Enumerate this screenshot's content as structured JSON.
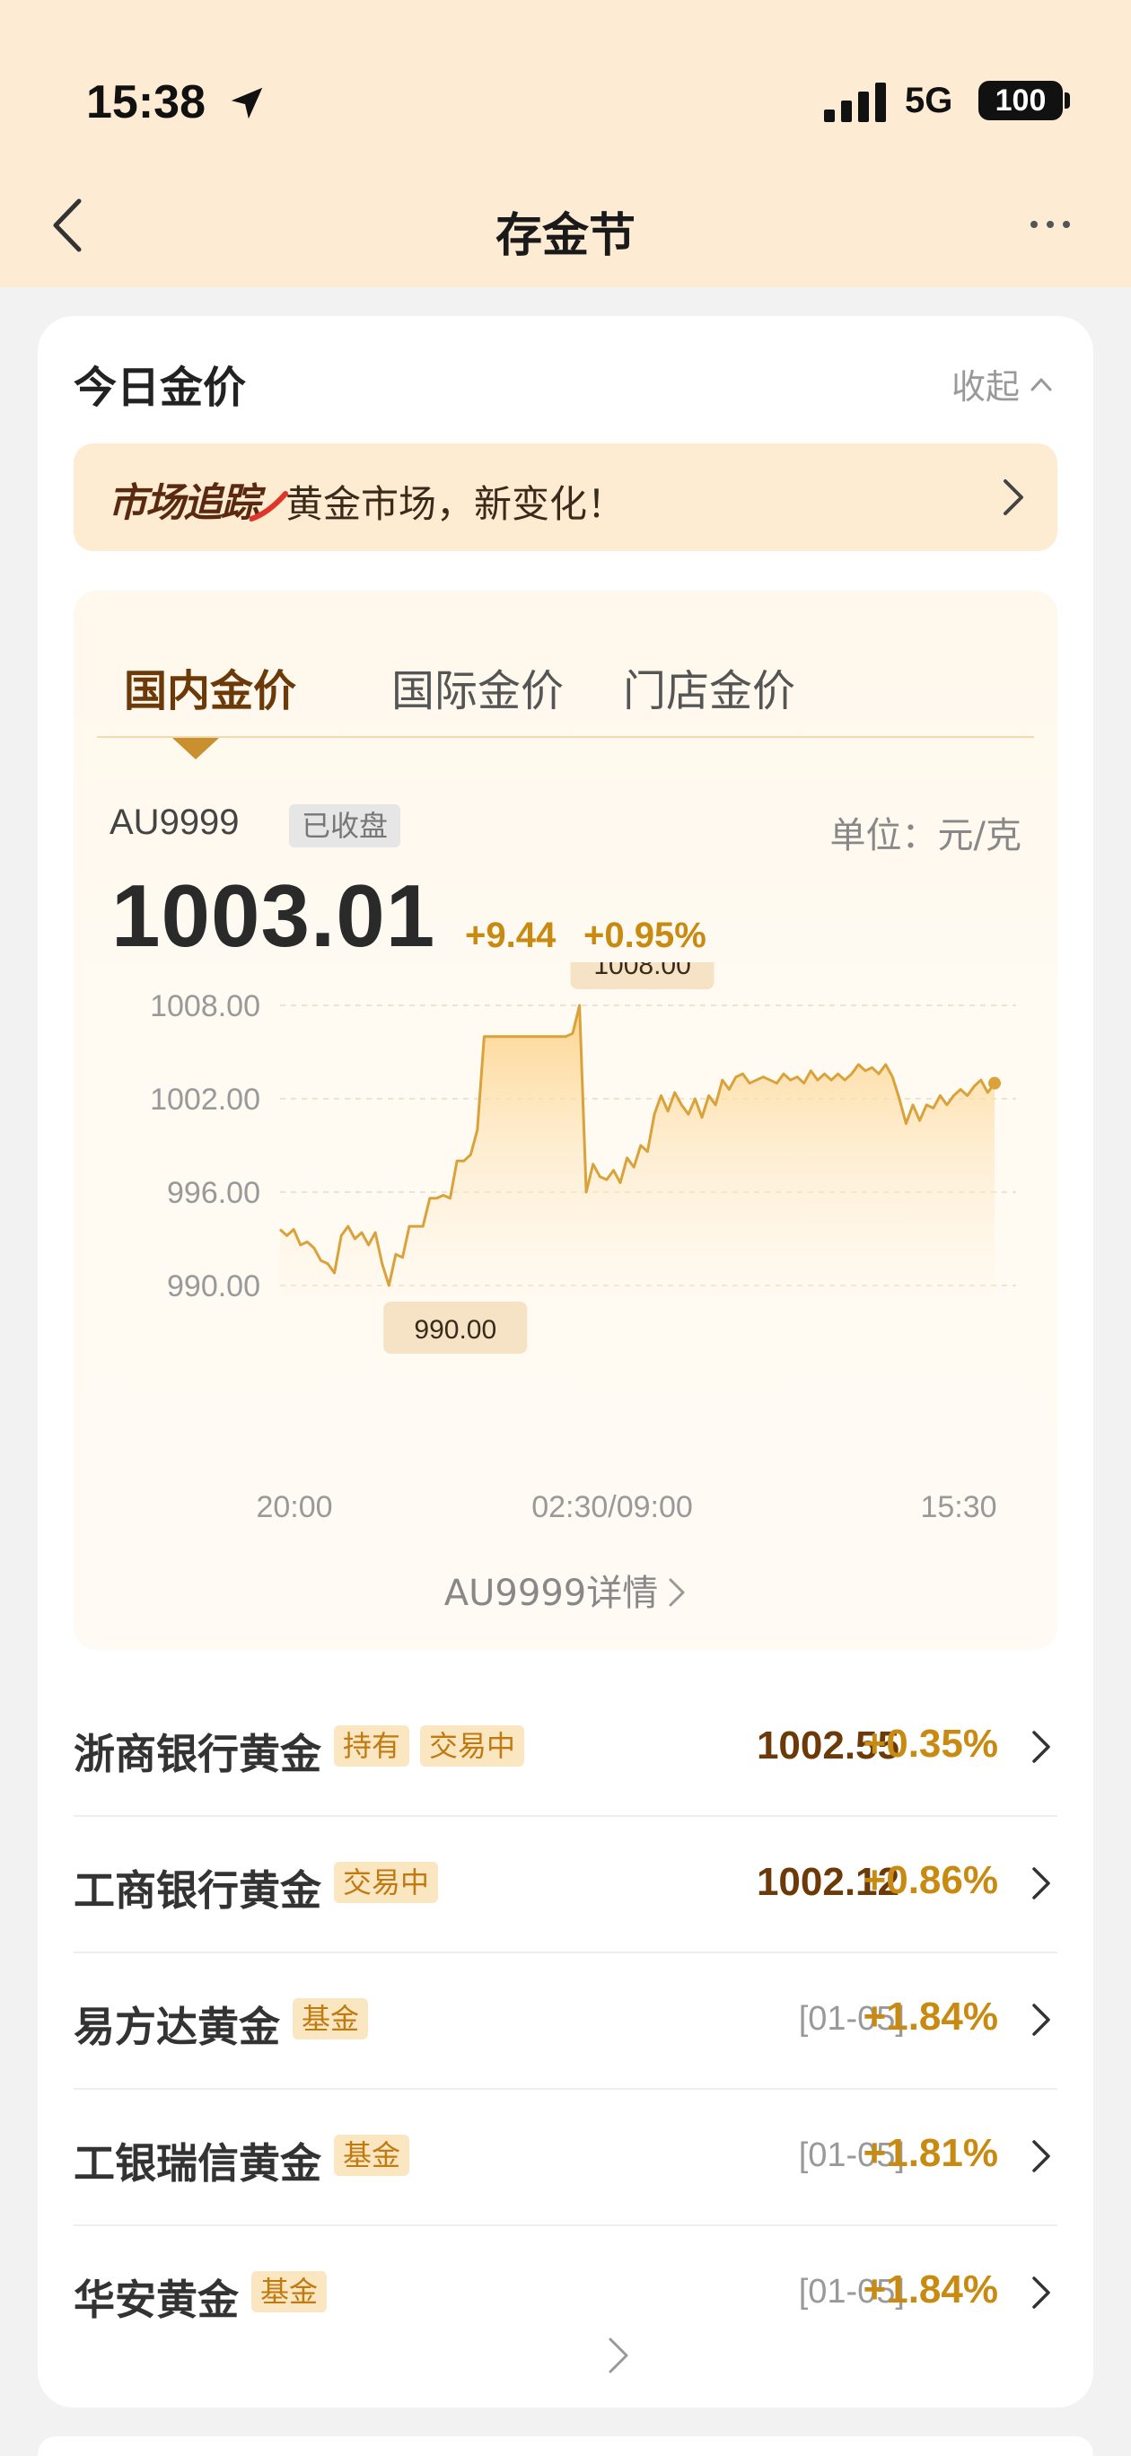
{
  "status_bar": {
    "time": "15:38",
    "network": "5G",
    "battery": "100",
    "icons": [
      "location-arrow-icon",
      "signal-icon",
      "battery-icon"
    ]
  },
  "nav": {
    "title": "存金节",
    "icons": [
      "back-icon",
      "more-icon"
    ]
  },
  "card": {
    "title": "今日金价",
    "collapse_label": "收起"
  },
  "banner": {
    "brand": "市场追踪",
    "text": "黄金市场，新变化！"
  },
  "tabs": [
    {
      "label": "国内金价",
      "active": true
    },
    {
      "label": "国际金价",
      "active": false
    },
    {
      "label": "门店金价",
      "active": false
    }
  ],
  "quote": {
    "symbol": "AU9999",
    "status": "已收盘",
    "unit": "单位：元/克",
    "price": "1003.01",
    "change": "+9.44",
    "change_pct": "+0.95%"
  },
  "chart_data": {
    "type": "area",
    "y_ticks": [
      "1008.00",
      "1002.00",
      "996.00",
      "990.00"
    ],
    "x_ticks": [
      "20:00",
      "02:30/09:00",
      "15:30"
    ],
    "ylim": [
      990,
      1008
    ],
    "max_label": "1008.00",
    "min_label": "990.00",
    "colors": {
      "line": "#d9a23a",
      "fill_top": "#fcd38a",
      "fill_bottom": "#fff6e6"
    },
    "series": [
      {
        "values": [
          993.6,
          993.2,
          993.6,
          992.6,
          992.8,
          992.4,
          991.6,
          991.4,
          990.8,
          993.2,
          993.8,
          993.0,
          993.4,
          992.6,
          993.4,
          991.4,
          990.0,
          992.0,
          991.8,
          993.8,
          993.8,
          993.8,
          995.6,
          995.6,
          995.8,
          995.6,
          998.0,
          998.0,
          998.4,
          1000.0,
          1006.0,
          1006.0,
          1006.0,
          1006.0,
          1006.0,
          1006.0,
          1006.0,
          1006.0,
          1006.0,
          1006.0,
          1006.0,
          1006.0,
          1006.0,
          1006.2,
          1008.0,
          996.0,
          997.8,
          997.0,
          996.8,
          997.4,
          996.6,
          998.2,
          997.6,
          999.0,
          998.6,
          1001.0,
          1002.2,
          1001.2,
          1002.4,
          1001.6,
          1001.0,
          1002.0,
          1000.8,
          1002.2,
          1001.6,
          1003.2,
          1002.6,
          1003.4,
          1003.6,
          1003.0,
          1003.2,
          1003.4,
          1003.2,
          1003.0,
          1003.6,
          1003.2,
          1003.4,
          1003.0,
          1003.8,
          1003.2,
          1003.6,
          1003.2,
          1003.6,
          1003.2,
          1003.6,
          1004.2,
          1003.8,
          1004.0,
          1003.6,
          1004.2,
          1003.4,
          1002.0,
          1000.4,
          1001.6,
          1000.6,
          1001.6,
          1001.4,
          1002.2,
          1001.6,
          1002.2,
          1002.6,
          1002.2,
          1002.8,
          1003.2,
          1002.4,
          1003.0
        ]
      }
    ]
  },
  "detail_link": "AU9999详情",
  "products": [
    {
      "name": "浙商银行黄金",
      "tags": [
        "持有",
        "交易中"
      ],
      "value": "1002.55",
      "pct": "+0.35%"
    },
    {
      "name": "工商银行黄金",
      "tags": [
        "交易中"
      ],
      "value": "1002.12",
      "pct": "+0.86%"
    },
    {
      "name": "易方达黄金",
      "tags": [
        "基金"
      ],
      "date": "[01-05]",
      "pct": "+1.84%"
    },
    {
      "name": "工银瑞信黄金",
      "tags": [
        "基金"
      ],
      "date": "[01-05]",
      "pct": "+1.81%"
    },
    {
      "name": "华安黄金",
      "tags": [
        "基金"
      ],
      "date": "[01-05]",
      "pct": "+1.84%"
    }
  ]
}
